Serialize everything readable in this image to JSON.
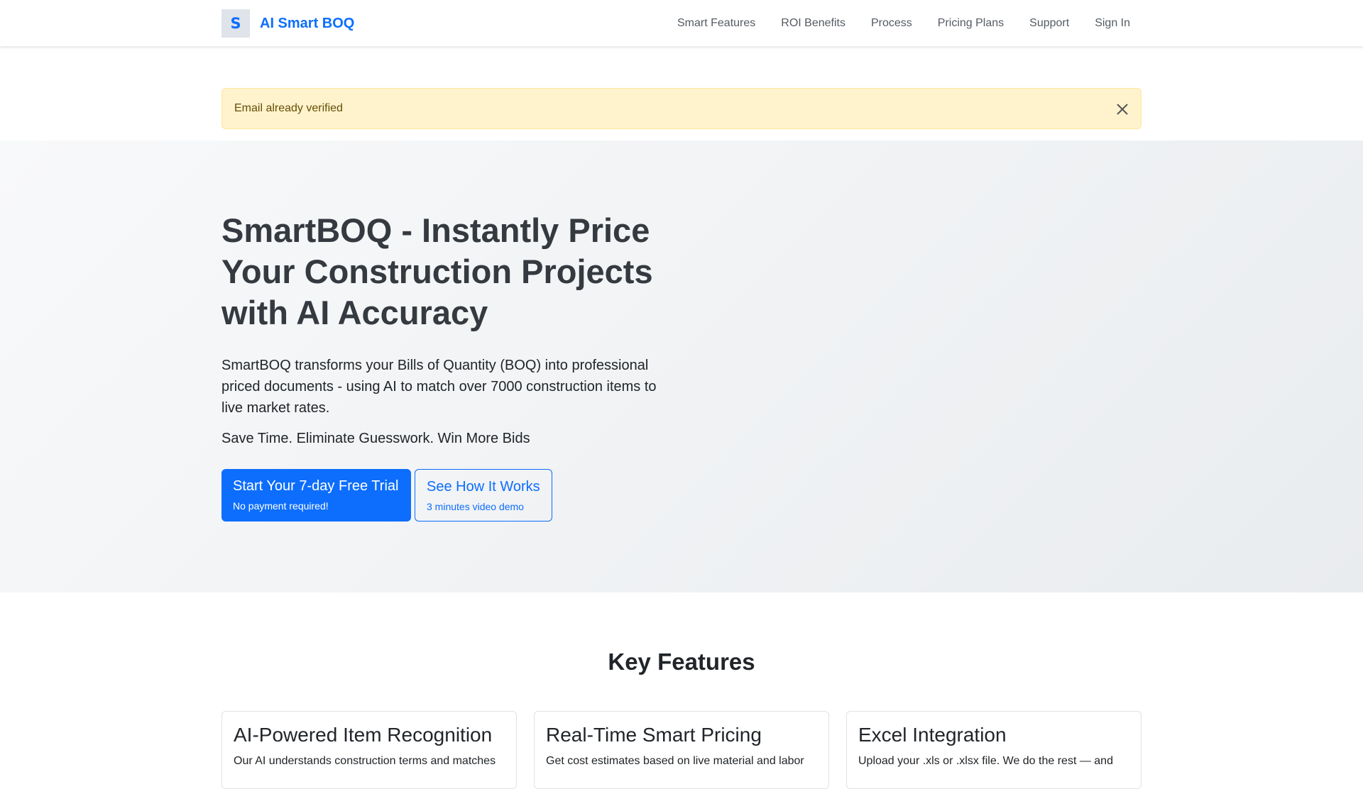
{
  "brand": {
    "logo_letter": "S",
    "name": "AI Smart BOQ"
  },
  "nav": {
    "items": [
      {
        "label": "Smart Features"
      },
      {
        "label": "ROI Benefits"
      },
      {
        "label": "Process"
      },
      {
        "label": "Pricing Plans"
      },
      {
        "label": "Support"
      },
      {
        "label": "Sign In"
      }
    ]
  },
  "alert": {
    "message": "Email already verified",
    "close_icon": "close-icon"
  },
  "hero": {
    "title": "SmartBOQ - Instantly Price Your Construction Projects with AI Accuracy",
    "description": "SmartBOQ transforms your Bills of Quantity (BOQ) into professional priced documents - using AI to match over 7000 construction items to live market rates.",
    "tagline": "Save Time. Eliminate Guesswork. Win More Bids",
    "primary_button": {
      "label": "Start Your 7-day Free Trial",
      "sub": "No payment required!"
    },
    "secondary_button": {
      "label": "See How It Works",
      "sub": "3 minutes video demo"
    }
  },
  "features": {
    "title": "Key Features",
    "cards": [
      {
        "title": "AI-Powered Item Recognition",
        "text": "Our AI understands construction terms and matches"
      },
      {
        "title": "Real-Time Smart Pricing",
        "text": "Get cost estimates based on live material and labor"
      },
      {
        "title": "Excel Integration",
        "text": "Upload your .xls or .xlsx file. We do the rest — and"
      }
    ]
  },
  "colors": {
    "accent": "#0d6efd",
    "alert_bg": "#fff3cd",
    "alert_text": "#664d03",
    "hero_title": "#343a40"
  }
}
